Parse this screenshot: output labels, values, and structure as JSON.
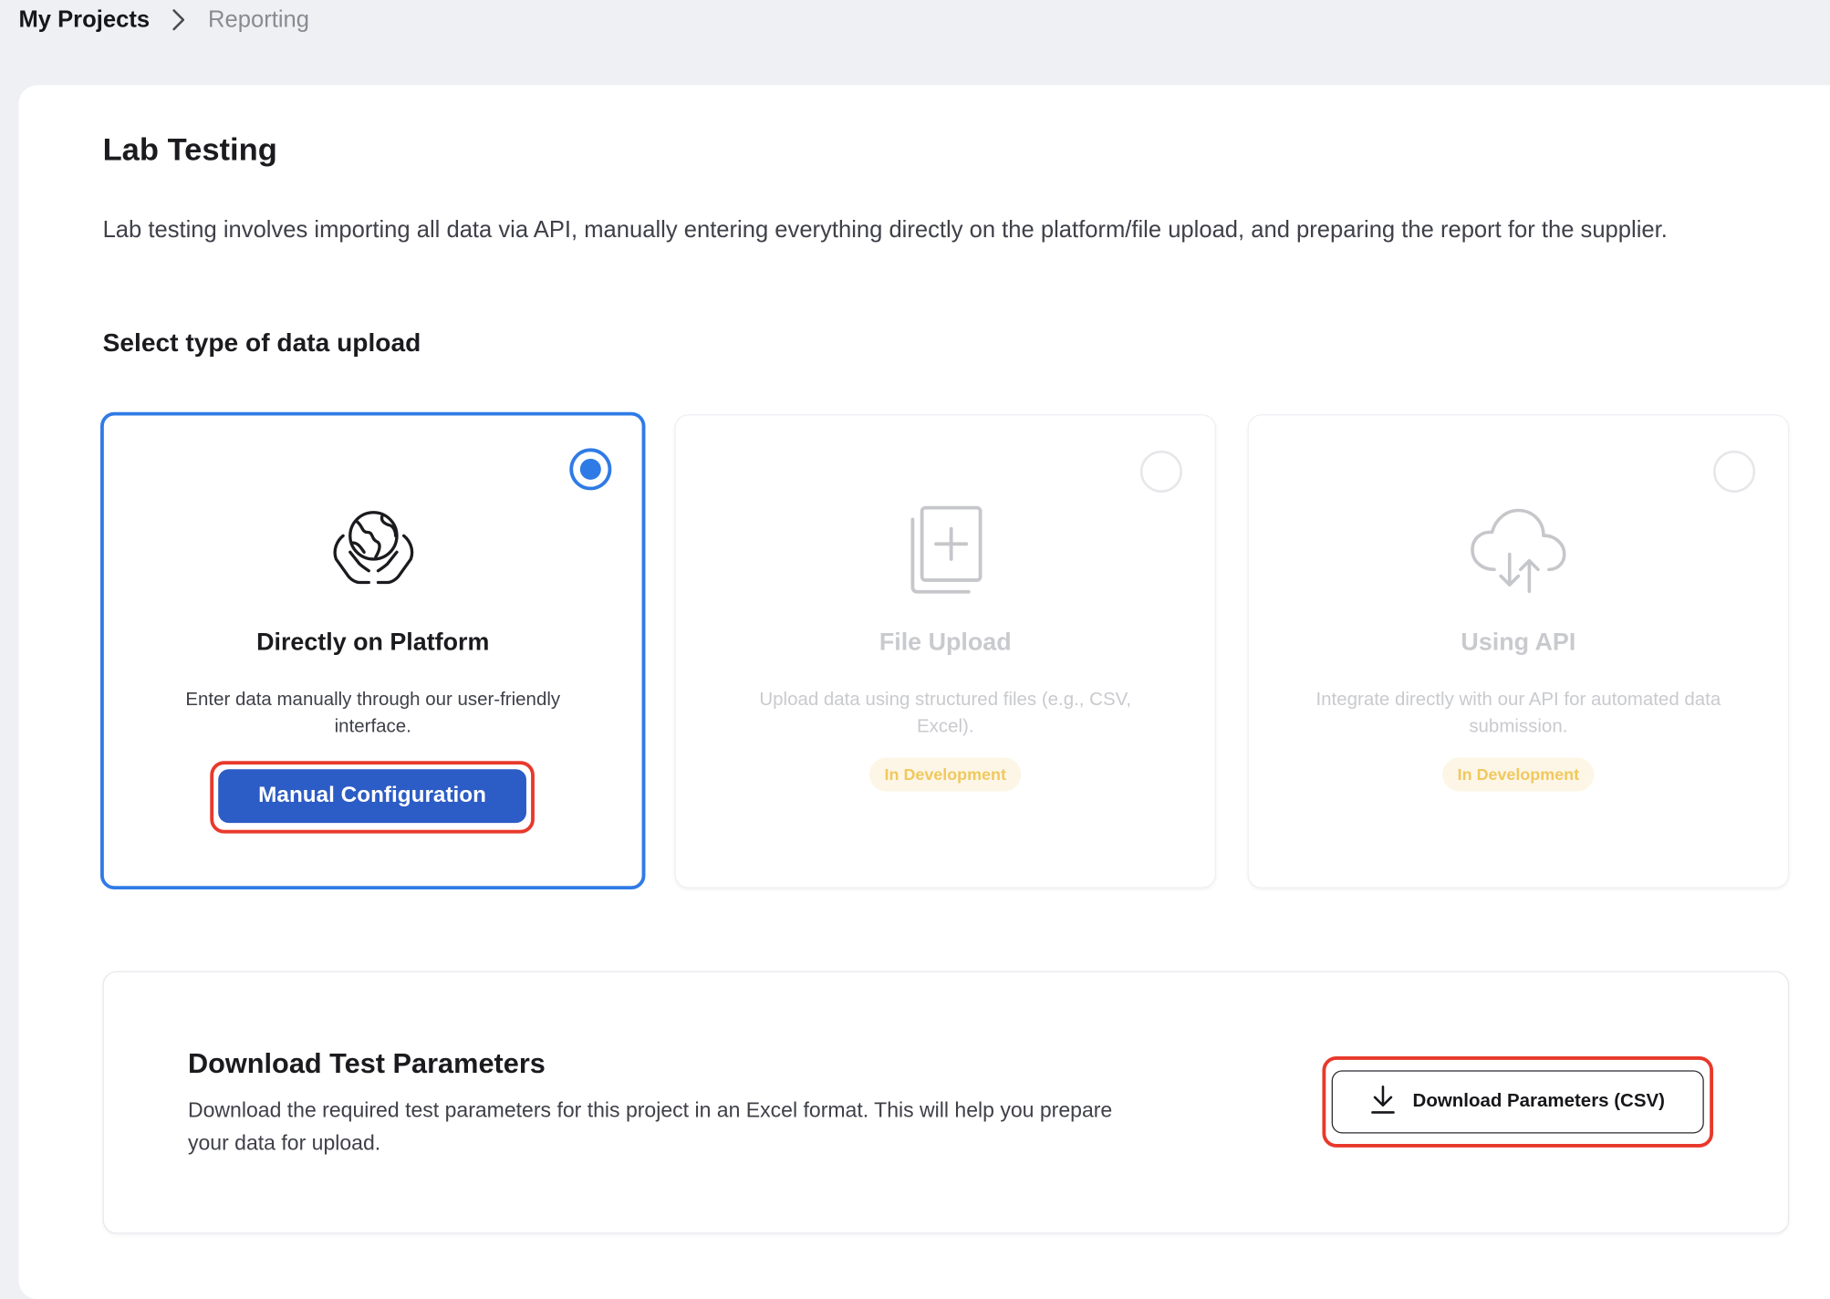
{
  "breadcrumb": {
    "root": "My Projects",
    "current": "Reporting"
  },
  "page": {
    "title": "Lab Testing",
    "description": "Lab testing involves importing all data via API, manually entering everything directly on the platform/file upload, and preparing the report for the supplier."
  },
  "upload_section": {
    "title": "Select type of data upload",
    "options": [
      {
        "title": "Directly on Platform",
        "description": "Enter data manually through our user-friendly interface.",
        "button_label": "Manual Configuration",
        "selected": true,
        "icon": "globe-in-hands-icon"
      },
      {
        "title": "File Upload",
        "description": "Upload data using structured files (e.g., CSV, Excel).",
        "badge": "In Development",
        "selected": false,
        "icon": "file-add-icon"
      },
      {
        "title": "Using API",
        "description": "Integrate directly with our API for automated data submission.",
        "badge": "In Development",
        "selected": false,
        "icon": "cloud-sync-icon"
      }
    ]
  },
  "download_section": {
    "title": "Download Test Parameters",
    "description": "Download the required test parameters for this project in an Excel format. This will help you prepare your data for upload.",
    "button_label": "Download Parameters (CSV)",
    "button_icon": "download-icon"
  },
  "colors": {
    "accent": "#2f7be6",
    "primary_button": "#2c5cc5",
    "highlight": "#e8392b",
    "badge_bg": "#fdf6e6",
    "badge_text": "#f0c85e"
  }
}
